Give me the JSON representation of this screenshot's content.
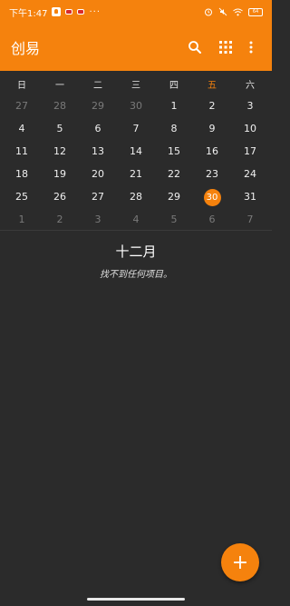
{
  "status_bar": {
    "time": "下午1:47",
    "more": "···",
    "battery": "64"
  },
  "app_bar": {
    "title": "创易"
  },
  "calendar": {
    "weekdays": [
      "日",
      "一",
      "二",
      "三",
      "四",
      "五",
      "六"
    ],
    "weeks": [
      [
        {
          "d": "27",
          "dim": true
        },
        {
          "d": "28",
          "dim": true
        },
        {
          "d": "29",
          "dim": true
        },
        {
          "d": "30",
          "dim": true
        },
        {
          "d": "1"
        },
        {
          "d": "2"
        },
        {
          "d": "3"
        }
      ],
      [
        {
          "d": "4"
        },
        {
          "d": "5"
        },
        {
          "d": "6"
        },
        {
          "d": "7"
        },
        {
          "d": "8"
        },
        {
          "d": "9"
        },
        {
          "d": "10"
        }
      ],
      [
        {
          "d": "11"
        },
        {
          "d": "12"
        },
        {
          "d": "13"
        },
        {
          "d": "14"
        },
        {
          "d": "15"
        },
        {
          "d": "16"
        },
        {
          "d": "17"
        }
      ],
      [
        {
          "d": "18"
        },
        {
          "d": "19"
        },
        {
          "d": "20"
        },
        {
          "d": "21"
        },
        {
          "d": "22"
        },
        {
          "d": "23"
        },
        {
          "d": "24"
        }
      ],
      [
        {
          "d": "25"
        },
        {
          "d": "26"
        },
        {
          "d": "27"
        },
        {
          "d": "28"
        },
        {
          "d": "29"
        },
        {
          "d": "30",
          "today": true
        },
        {
          "d": "31"
        }
      ],
      [
        {
          "d": "1",
          "dim": true
        },
        {
          "d": "2",
          "dim": true
        },
        {
          "d": "3",
          "dim": true
        },
        {
          "d": "4",
          "dim": true
        },
        {
          "d": "5",
          "dim": true
        },
        {
          "d": "6",
          "dim": true
        },
        {
          "d": "7",
          "dim": true
        }
      ]
    ]
  },
  "month_view": {
    "month_title": "十二月",
    "empty_message": "找不到任何项目。"
  },
  "colors": {
    "accent": "#f5820d",
    "background": "#2b2b2b"
  },
  "icons": {
    "search": "search-icon",
    "grid": "grid-icon",
    "more": "more-vert-icon",
    "add": "plus-icon"
  },
  "fab": {
    "label": "+"
  }
}
